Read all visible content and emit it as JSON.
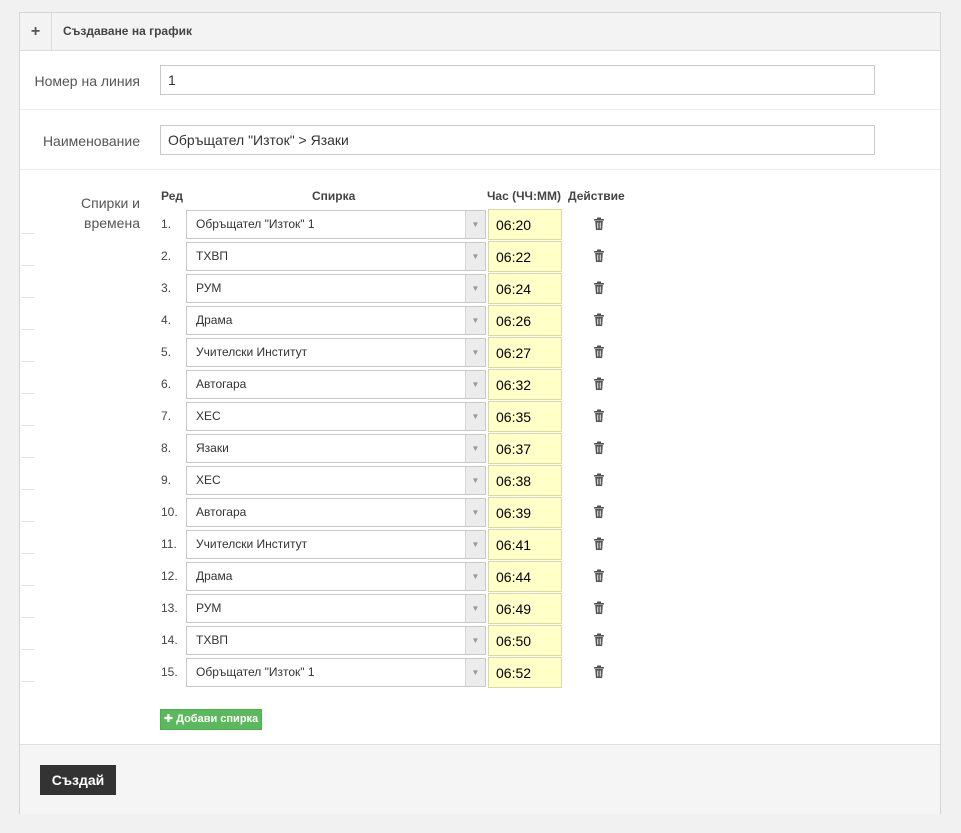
{
  "header": {
    "toggle_icon": "plus-icon",
    "title": "Създаване на график"
  },
  "line_number": {
    "label": "Номер на линия",
    "value": "1"
  },
  "name": {
    "label": "Наименование",
    "value": "Обръщател \"Изток\" > Язаки"
  },
  "stops": {
    "label_line1": "Спирки и",
    "label_line2": "времена",
    "columns": {
      "order": "Ред",
      "stop": "Спирка",
      "time": "Час (ЧЧ:ММ)",
      "action": "Действие"
    },
    "rows": [
      {
        "num": "1.",
        "stop": "Обръщател \"Изток\" 1",
        "time": "06:20"
      },
      {
        "num": "2.",
        "stop": "ТХВП",
        "time": "06:22"
      },
      {
        "num": "3.",
        "stop": "РУМ",
        "time": "06:24"
      },
      {
        "num": "4.",
        "stop": "Драма",
        "time": "06:26"
      },
      {
        "num": "5.",
        "stop": "Учителски Институт",
        "time": "06:27"
      },
      {
        "num": "6.",
        "stop": "Автогара",
        "time": "06:32"
      },
      {
        "num": "7.",
        "stop": "ХЕС",
        "time": "06:35"
      },
      {
        "num": "8.",
        "stop": "Язаки",
        "time": "06:37"
      },
      {
        "num": "9.",
        "stop": "ХЕС",
        "time": "06:38"
      },
      {
        "num": "10.",
        "stop": "Автогара",
        "time": "06:39"
      },
      {
        "num": "11.",
        "stop": "Учителски Институт",
        "time": "06:41"
      },
      {
        "num": "12.",
        "stop": "Драма",
        "time": "06:44"
      },
      {
        "num": "13.",
        "stop": "РУМ",
        "time": "06:49"
      },
      {
        "num": "14.",
        "stop": "ТХВП",
        "time": "06:50"
      },
      {
        "num": "15.",
        "stop": "Обръщател \"Изток\" 1",
        "time": "06:52"
      }
    ],
    "add_button": "Добави спирка",
    "add_icon": "plus-icon",
    "delete_icon": "trash-icon"
  },
  "submit_button": "Създай",
  "colors": {
    "time_bg": "#ffffc8",
    "add_button": "#5cb85c",
    "submit_button": "#333333"
  }
}
